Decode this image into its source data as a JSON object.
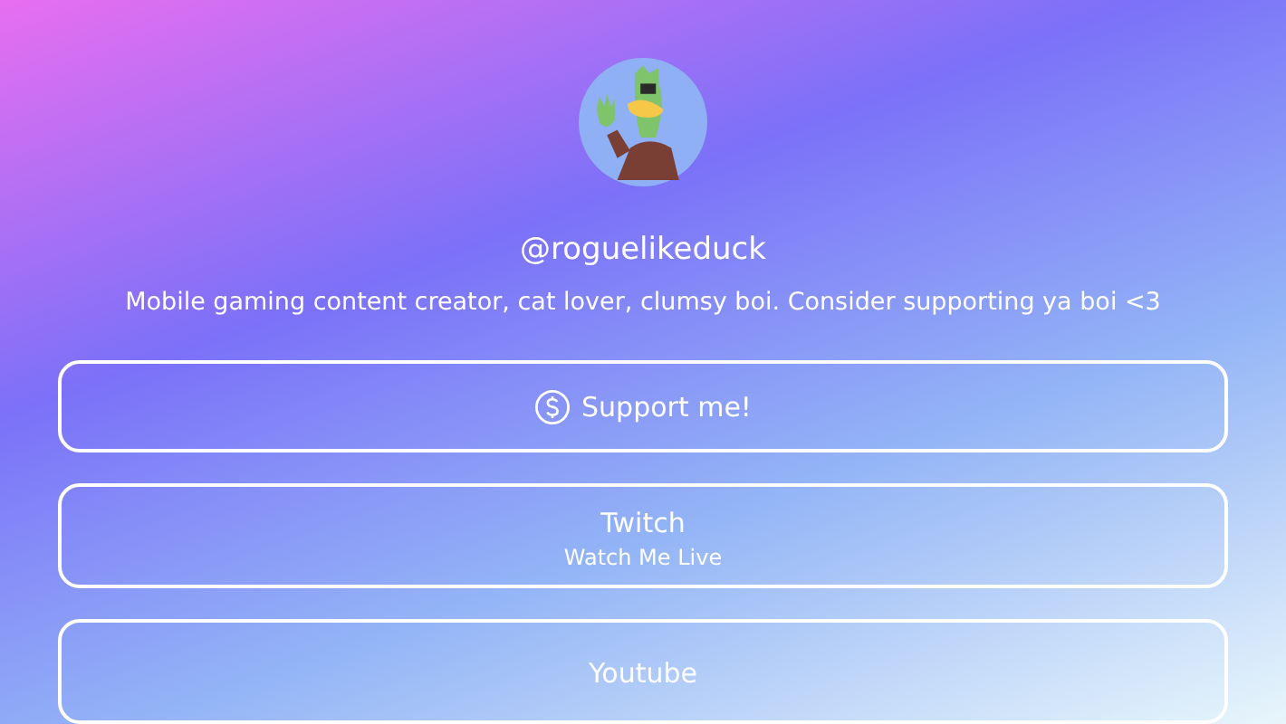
{
  "profile": {
    "handle": "@roguelikeduck",
    "bio": "Mobile gaming content creator, cat lover, clumsy boi. Consider supporting ya boi <3"
  },
  "links": [
    {
      "kind": "support",
      "title": "Support me!"
    },
    {
      "kind": "link",
      "title": "Twitch",
      "subtitle": "Watch Me Live"
    },
    {
      "kind": "link",
      "title": "Youtube"
    }
  ]
}
